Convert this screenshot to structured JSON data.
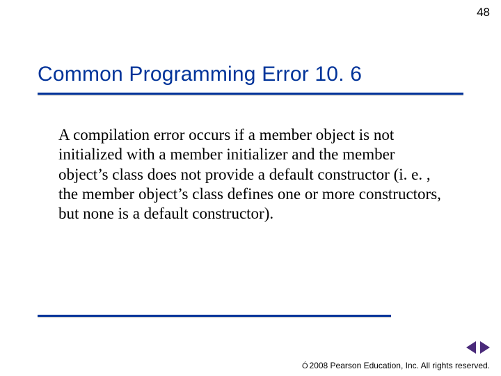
{
  "page_number": "48",
  "heading": "Common Programming Error 10. 6",
  "body": "A compilation error occurs if a member object is not initialized with a member initializer and the member object’s class does not provide a default constructor (i. e. , the member object’s class defines one or more constructors, but none is a default constructor).",
  "footer": {
    "copyright_symbol": "Ó",
    "text": "2008 Pearson Education, Inc.  All rights reserved."
  },
  "colors": {
    "heading": "#003399",
    "rule": "#003399",
    "arrow": "#4a2a7a"
  }
}
